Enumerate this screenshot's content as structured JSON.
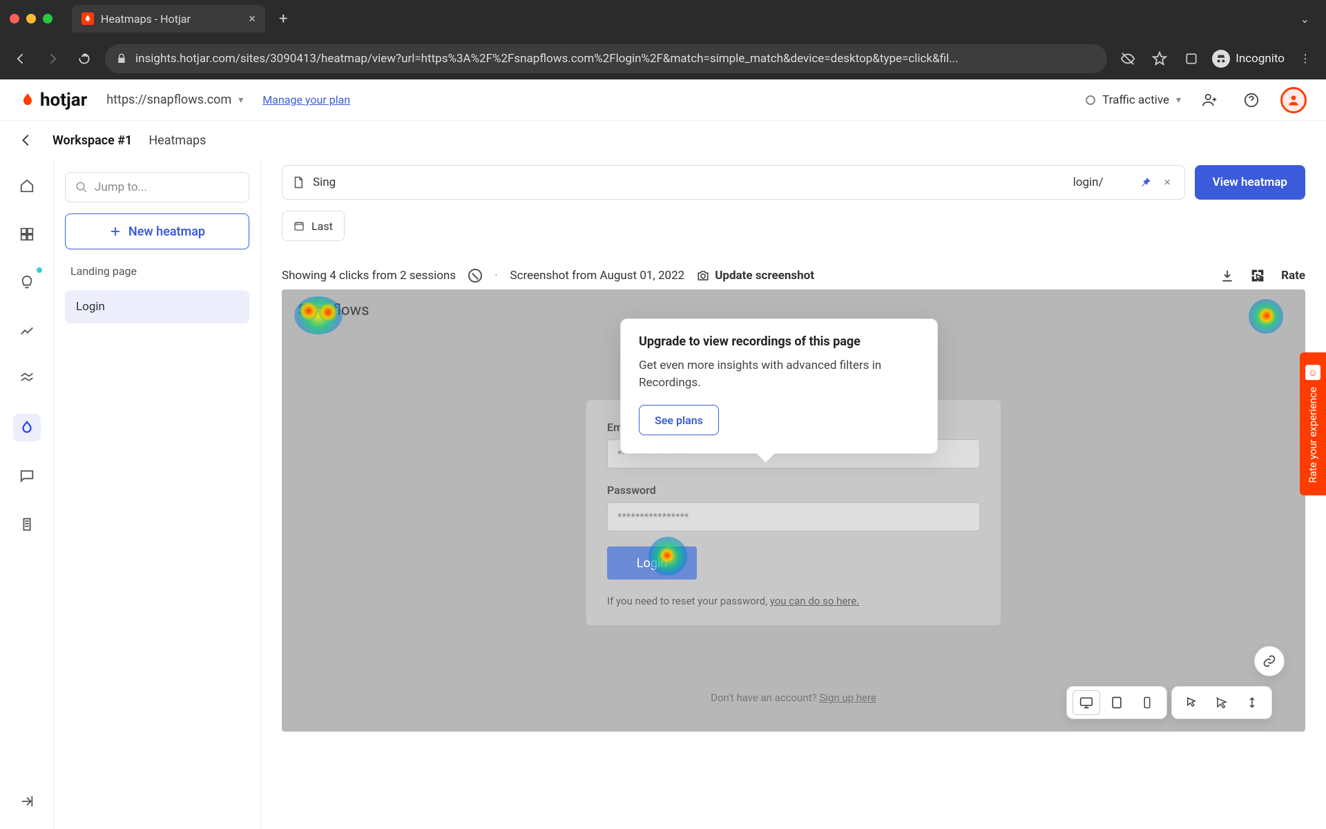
{
  "browser": {
    "tab_title": "Heatmaps - Hotjar",
    "url": "insights.hotjar.com/sites/3090413/heatmap/view?url=https%3A%2F%2Fsnapflows.com%2Flogin%2F&match=simple_match&device=desktop&type=click&fil...",
    "incognito_label": "Incognito"
  },
  "header": {
    "logo_text": "hotjar",
    "site_selected": "https://snapflows.com",
    "manage_plan": "Manage your plan",
    "traffic_status": "Traffic active"
  },
  "breadcrumb": {
    "workspace": "Workspace #1",
    "page": "Heatmaps"
  },
  "sidebar": {
    "jump_placeholder": "Jump to...",
    "new_heatmap": "New heatmap",
    "group_label": "Landing page",
    "items": [
      {
        "label": "Login",
        "active": true
      }
    ]
  },
  "controls": {
    "match_type": "Sing",
    "url_value": "login/",
    "view_button": "View heatmap",
    "filter_date": "Last"
  },
  "popover": {
    "title": "Upgrade to view recordings of this page",
    "body": "Get even more insights with advanced filters in Recordings.",
    "cta": "See plans"
  },
  "stats": {
    "showing": "Showing 4 clicks from 2 sessions",
    "screenshot_from": "Screenshot from August 01, 2022",
    "update": "Update screenshot",
    "rate": "Rate"
  },
  "preview": {
    "brand": "Snapflows",
    "email_label": "Email",
    "email_value": "****************",
    "password_label": "Password",
    "password_value": "****************",
    "login_button": "Login",
    "reset_prefix": "If you need to reset your password, ",
    "reset_link": "you can do so here.",
    "signup_prefix": "Don't have an account? ",
    "signup_link": "Sign up here"
  },
  "rate_tab": "Rate your experience"
}
